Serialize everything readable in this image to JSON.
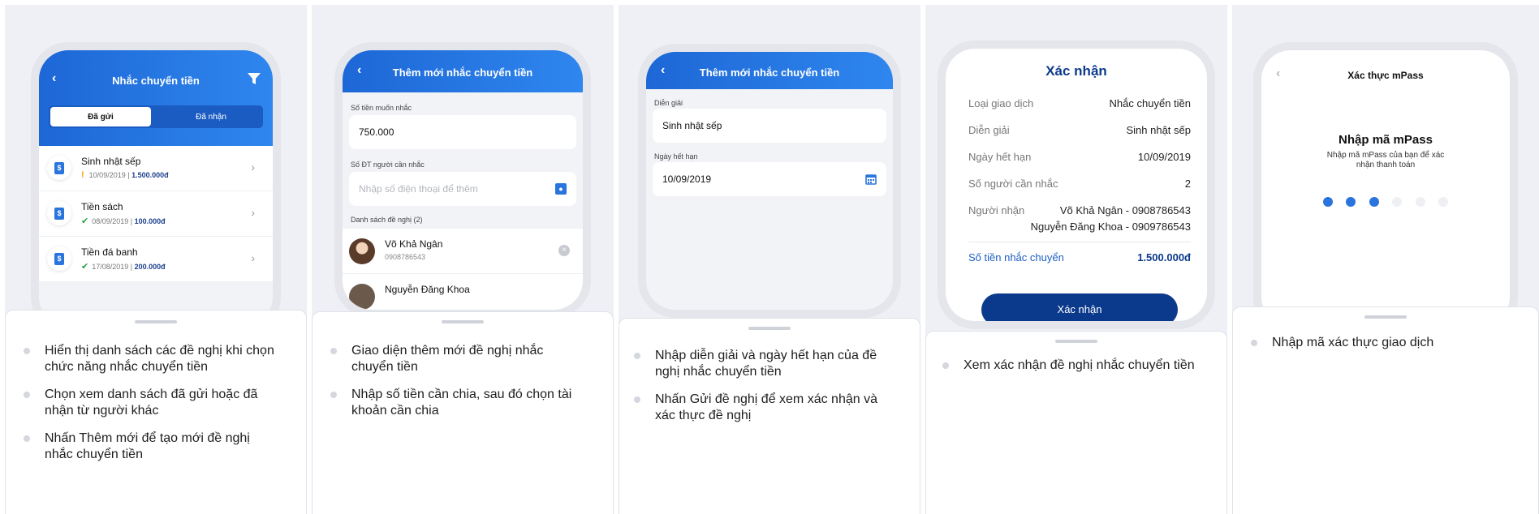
{
  "colors": {
    "brand_blue": "#2a74dd",
    "navy": "#0b3a8c",
    "warning": "#f5a100",
    "success": "#25a244"
  },
  "panel1": {
    "title": "Nhắc chuyển tiền",
    "tabs": [
      "Đã gửi",
      "Đã nhận"
    ],
    "items": [
      {
        "title": "Sinh nhật sếp",
        "status": "warning",
        "date": "10/09/2019",
        "amount": "1.500.000đ"
      },
      {
        "title": "Tiền sách",
        "status": "success",
        "date": "08/09/2019",
        "amount": "100.000đ"
      },
      {
        "title": "Tiền đá banh",
        "status": "success",
        "date": "17/08/2019",
        "amount": "200.000đ"
      }
    ],
    "bullets": [
      "Hiển thị danh sách các đề nghị khi chọn chức năng nhắc chuyển tiền",
      "Chọn xem danh sách đã gửi hoặc đã nhận từ người khác",
      "Nhấn Thêm mới để tạo mới đề nghị nhắc chuyển tiền"
    ]
  },
  "panel2": {
    "title": "Thêm mới nhắc chuyển tiền",
    "amount_label": "Số tiền muốn nhắc",
    "amount_value": "750.000",
    "phone_label": "Số ĐT người cần nhắc",
    "phone_placeholder": "Nhập số điện thoại để thêm",
    "list_label": "Danh sách đề nghị (2)",
    "people": [
      {
        "name": "Võ Khả Ngân",
        "phone": "0908786543"
      },
      {
        "name": "Nguyễn Đăng Khoa"
      }
    ],
    "bullets": [
      "Giao diện thêm mới đề nghị nhắc chuyển tiền",
      "Nhập số tiền cần chia, sau đó chọn tài khoản cần chia"
    ]
  },
  "panel3": {
    "title": "Thêm mới nhắc chuyển tiền",
    "desc_label": "Diễn giải",
    "desc_value": "Sinh nhật sếp",
    "due_label": "Ngày hết hạn",
    "due_value": "10/09/2019",
    "bullets": [
      "Nhập diễn giải và ngày hết hạn của đề nghị nhắc chuyển tiền",
      "Nhấn Gửi đề nghị để xem xác nhận và xác thực đề nghị"
    ]
  },
  "panel4": {
    "title": "Xác nhận",
    "rows": [
      {
        "key": "Loại giao dịch",
        "value": "Nhắc chuyển tiền"
      },
      {
        "key": "Diễn giải",
        "value": "Sinh nhật sếp"
      },
      {
        "key": "Ngày hết hạn",
        "value": "10/09/2019"
      },
      {
        "key": "Số người cần nhắc",
        "value": "2"
      }
    ],
    "recipient_label": "Người nhận",
    "recipients": [
      "Võ Khả Ngân - 0908786543",
      "Nguyễn Đăng Khoa - 0909786543"
    ],
    "total_label": "Số tiền nhắc chuyển",
    "total_value": "1.500.000đ",
    "confirm_button": "Xác nhận",
    "bullets": [
      "Xem xác nhận đề nghị nhắc chuyển tiền"
    ]
  },
  "panel5": {
    "title": "Xác thực mPass",
    "heading": "Nhập mã mPass",
    "subtitle": "Nhập mã mPass của bạn để xác nhận thanh toán",
    "pin_filled": 3,
    "pin_total": 6,
    "bullets": [
      "Nhập mã xác thực giao dịch"
    ]
  }
}
